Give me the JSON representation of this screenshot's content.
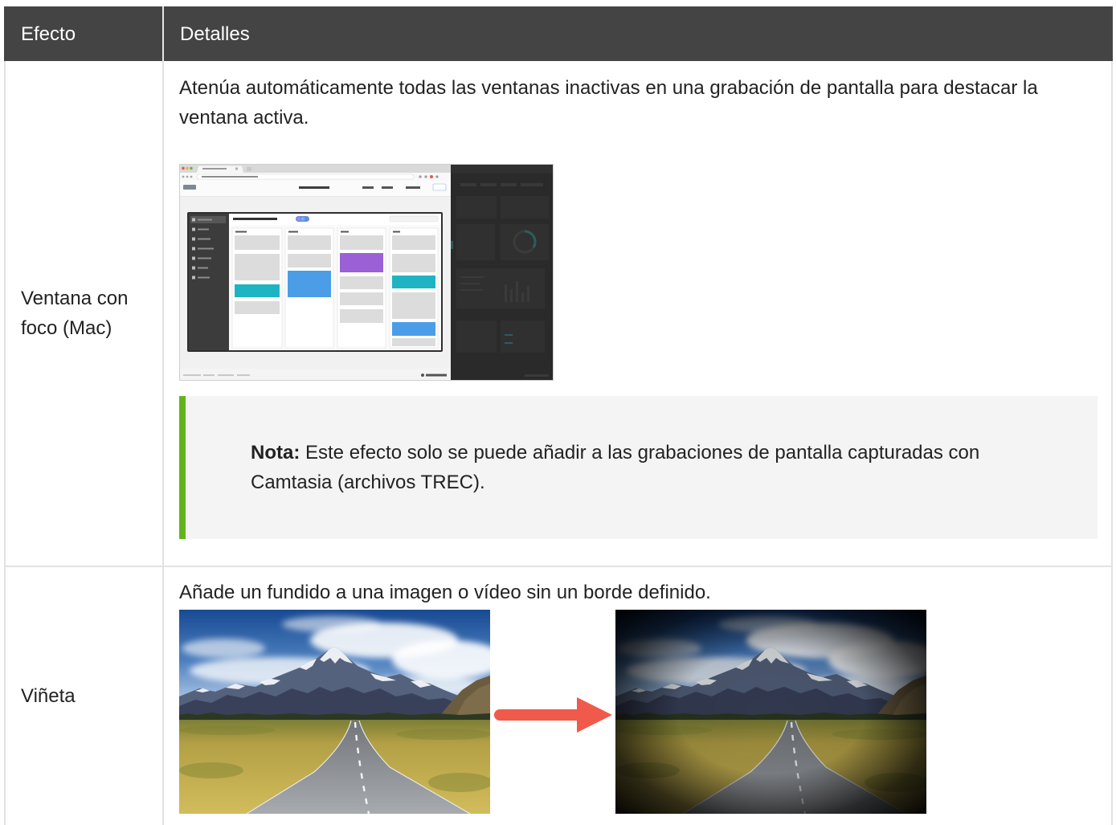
{
  "table": {
    "headers": {
      "effect": "Efecto",
      "details": "Detalles"
    },
    "rows": [
      {
        "effect": "Ventana con foco (Mac)",
        "description": "Atenúa automáticamente todas las ventanas inactivas en una grabación de pantalla para destacar la ventana activa.",
        "note": {
          "label": "Nota:",
          "text": "Este efecto solo se puede añadir a las grabaciones de pantalla capturadas con Camtasia (archivos TREC)."
        }
      },
      {
        "effect": "Viñeta",
        "description": "Añade un fundido a una imagen o vídeo sin un borde definido.",
        "transition_icon": "arrow-right-icon"
      }
    ]
  },
  "colors": {
    "header_background": "#444444",
    "header_text": "#ffffff",
    "body_text": "#222222",
    "grid_lines": "#e2e2e2",
    "note_background": "#f4f4f4",
    "note_accent": "#62b41c",
    "arrow": "#f05a4b"
  }
}
